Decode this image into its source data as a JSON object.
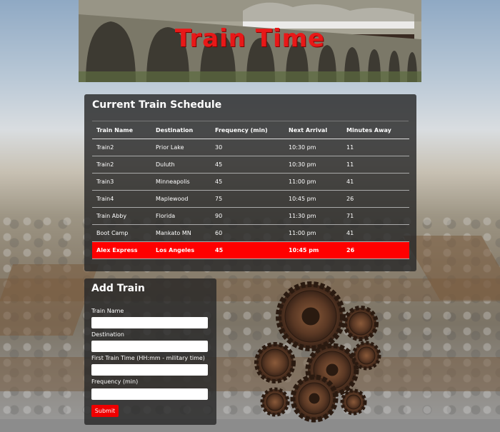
{
  "banner": {
    "title": "Train Time"
  },
  "schedule": {
    "heading": "Current Train Schedule",
    "columns": [
      "Train Name",
      "Destination",
      "Frequency (min)",
      "Next Arrival",
      "Minutes Away"
    ],
    "rows": [
      [
        "Train2",
        "Prior Lake",
        "30",
        "10:30 pm",
        "11"
      ],
      [
        "Train2",
        "Duluth",
        "45",
        "10:30 pm",
        "11"
      ],
      [
        "Train3",
        "Minneapolis",
        "45",
        "11:00 pm",
        "41"
      ],
      [
        "Train4",
        "Maplewood",
        "75",
        "10:45 pm",
        "26"
      ],
      [
        "Train Abby",
        "Florida",
        "90",
        "11:30 pm",
        "71"
      ],
      [
        "Boot Camp",
        "Mankato MN",
        "60",
        "11:00 pm",
        "41"
      ],
      [
        "Alex Express",
        "Los Angeles",
        "45",
        "10:45 pm",
        "26"
      ]
    ],
    "highlight_color": "#ff0000"
  },
  "form": {
    "heading": "Add Train",
    "train_name_label": "Train Name",
    "destination_label": "Destination",
    "first_time_label": "First Train Time (HH:mm - military time)",
    "frequency_label": "Frequency (min)",
    "submit_label": "Submit",
    "accent_color": "#e00000"
  }
}
